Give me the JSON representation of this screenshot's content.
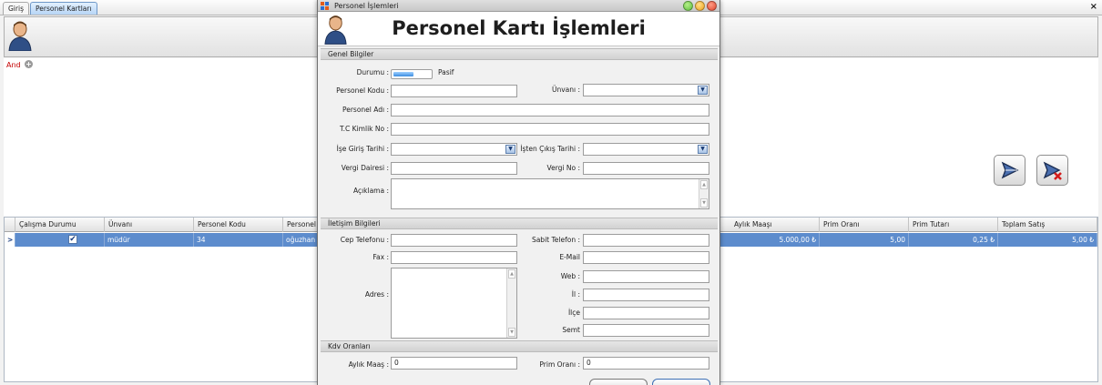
{
  "tabs": [
    "Giriş",
    "Personel Kartları"
  ],
  "close_glyph": "×",
  "filter": {
    "and_label": "And",
    "add_icon": "+"
  },
  "grid": {
    "columns": [
      "Çalışma Durumu",
      "Ünvanı",
      "Personel Kodu",
      "Personel",
      "Aylık Maaşı",
      "Prim Oranı",
      "Prim Tutarı",
      "Toplam Satış"
    ],
    "row": {
      "indicator": ">",
      "calisma_durumu": true,
      "unvani": "müdür",
      "personel_kodu": "34",
      "personel": "oğuzhan",
      "aylik_maasi": "5.000,00 ₺",
      "prim_orani": "5,00",
      "prim_tutari": "0,25 ₺",
      "toplam_satis": "5,00 ₺"
    }
  },
  "modal": {
    "window_title": "Personel İşlemleri",
    "header_title": "Personel Kartı İşlemleri",
    "sections": {
      "genel": "Genel Bilgiler",
      "iletisim": "İletişim Bilgileri",
      "kdv": "Kdv Oranları"
    },
    "labels": {
      "durumu": "Durumu :",
      "pasif": "Pasif",
      "personel_kodu": "Personel Kodu :",
      "unvani": "Ünvanı :",
      "personel_adi": "Personel Adı :",
      "tc_kimlik": "T.C Kimlik No :",
      "ise_giris": "İşe Giriş Tarihi :",
      "isten_cikis": "İşten Çıkış Tarihi :",
      "vergi_dairesi": "Vergi Dairesi :",
      "vergi_no": "Vergi No :",
      "aciklama": "Açıklama :",
      "cep_telefonu": "Cep Telefonu :",
      "sabit_telefon": "Sabit Telefon :",
      "fax": "Fax :",
      "email": "E-Mail",
      "adres": "Adres :",
      "web": "Web :",
      "il": "İl :",
      "ilce": "İlçe",
      "semt": "Semt",
      "aylik_maas": "Aylık Maaş :",
      "prim_orani": "Prim Oranı :"
    },
    "values": {
      "personel_kodu": "",
      "unvani": "",
      "personel_adi": "",
      "tc_kimlik": "",
      "ise_giris": "",
      "isten_cikis": "",
      "vergi_dairesi": "",
      "vergi_no": "",
      "aciklama": "",
      "cep_telefonu": "",
      "sabit_telefon": "",
      "fax": "",
      "email": "",
      "adres": "",
      "web": "",
      "il": "",
      "ilce": "",
      "semt": "",
      "aylik_maas": "0",
      "prim_orani": "0"
    },
    "toggle_state": "Pasif"
  },
  "colors": {
    "selection_row": "#5d8ccd",
    "and_text": "#c40000",
    "tab_active": "#b7d5f5",
    "win_min": "#5cbf3a",
    "win_max": "#f0a21c",
    "win_close": "#e0452d"
  },
  "icons": [
    "person-icon",
    "add-icon",
    "save-icon",
    "delete-icon",
    "dropdown-arrow-icon",
    "checkbox-icon"
  ]
}
